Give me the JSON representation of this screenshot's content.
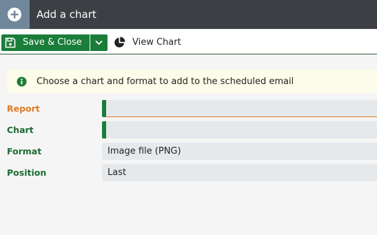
{
  "window": {
    "title": "Add a chart",
    "icon": "plus-circle-icon"
  },
  "toolbar": {
    "save_close_label": "Save & Close",
    "save_icon": "floppy-disk-icon",
    "dropdown_icon": "chevron-down-icon",
    "view_chart_label": "View Chart",
    "view_chart_icon": "pie-chart-icon"
  },
  "notice": {
    "icon": "info-icon",
    "text": "Choose a chart and format to add to the scheduled email"
  },
  "form": {
    "report": {
      "label": "Report",
      "value": ""
    },
    "chart": {
      "label": "Chart",
      "value": ""
    },
    "format": {
      "label": "Format",
      "value": "Image file (PNG)"
    },
    "position": {
      "label": "Position",
      "value": "Last"
    }
  },
  "colors": {
    "accent_green": "#1b7d3a",
    "active_orange": "#e07a1f",
    "titlebar": "#3c3f44",
    "notice_bg": "#fdfbe9"
  }
}
